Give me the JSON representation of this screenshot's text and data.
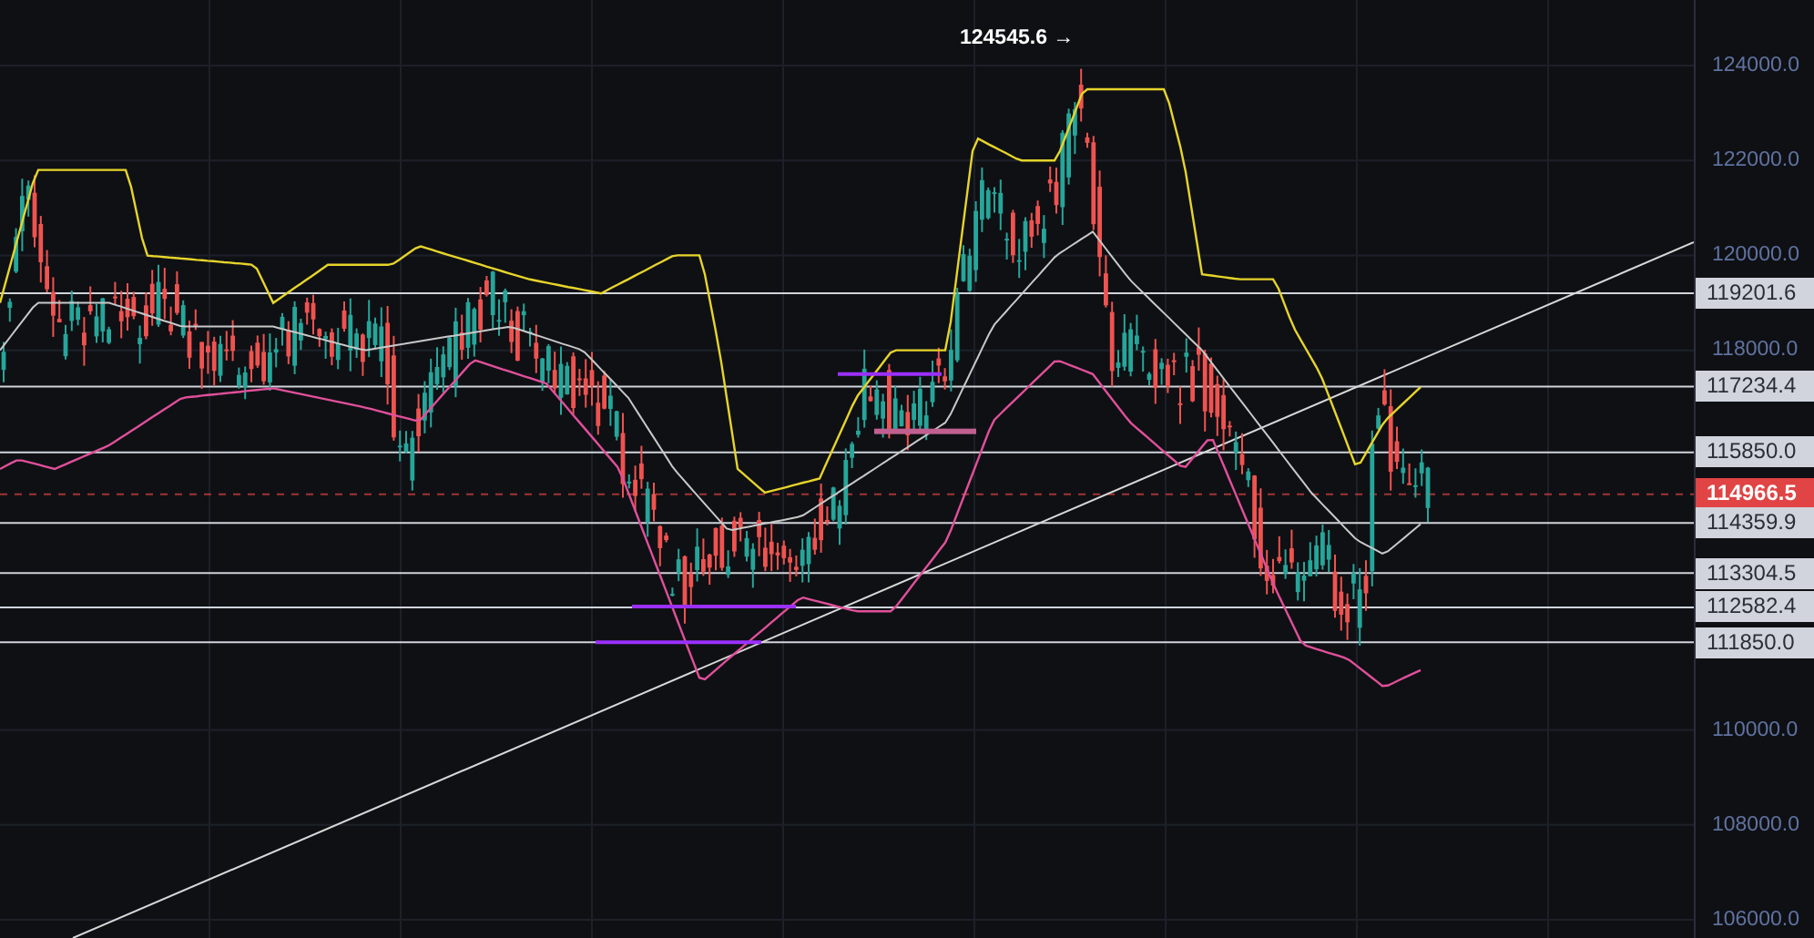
{
  "chart": {
    "peak_label": "124545.6 →",
    "price_axis": {
      "ticks": [
        "124000.0",
        "122000.0",
        "120000.0",
        "118000.0",
        "110000.0",
        "108000.0",
        "106000.0"
      ]
    },
    "levels": [
      {
        "label": "119201.6",
        "kind": "level"
      },
      {
        "label": "117234.4",
        "kind": "level"
      },
      {
        "label": "115850.0",
        "kind": "level"
      },
      {
        "label": "114966.5",
        "kind": "current"
      },
      {
        "label": "114359.9",
        "kind": "level"
      },
      {
        "label": "113304.5",
        "kind": "level"
      },
      {
        "label": "112582.4",
        "kind": "level"
      },
      {
        "label": "111850.0",
        "kind": "level"
      }
    ]
  }
}
